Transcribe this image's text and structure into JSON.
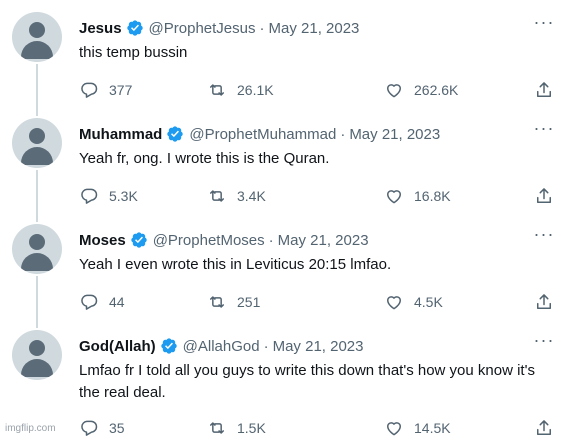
{
  "tweets": [
    {
      "name": "Jesus",
      "handle": "@ProphetJesus",
      "separator": "·",
      "date": "May 21, 2023",
      "more": "···",
      "text": "this temp bussin",
      "replies": "377",
      "retweets": "26.1K",
      "likes": "262.6K"
    },
    {
      "name": "Muhammad",
      "handle": "@ProphetMuhammad",
      "separator": "·",
      "date": "May 21, 2023",
      "more": "···",
      "text": "Yeah fr, ong. I wrote this is the Quran.",
      "replies": "5.3K",
      "retweets": "3.4K",
      "likes": "16.8K"
    },
    {
      "name": "Moses",
      "handle": "@ProphetMoses",
      "separator": "·",
      "date": "May 21, 2023",
      "more": "···",
      "text": "Yeah I even wrote this in Leviticus 20:15 lmfao.",
      "replies": "44",
      "retweets": "251",
      "likes": "4.5K"
    },
    {
      "name": "God(Allah)",
      "handle": "@AllahGod",
      "separator": "·",
      "date": "May 21, 2023",
      "more": "···",
      "text": "Lmfao fr I told all you guys to write this down that's how you know it's the real deal.",
      "replies": "35",
      "retweets": "1.5K",
      "likes": "14.5K"
    }
  ],
  "icons": {
    "verified": "verified-badge-icon",
    "reply": "reply-icon",
    "retweet": "retweet-icon",
    "like": "heart-icon",
    "share": "share-icon"
  },
  "colors": {
    "verified": "#1d9bf0",
    "muted": "#536471",
    "text": "#0f1419"
  },
  "watermark": "imgflip.com"
}
